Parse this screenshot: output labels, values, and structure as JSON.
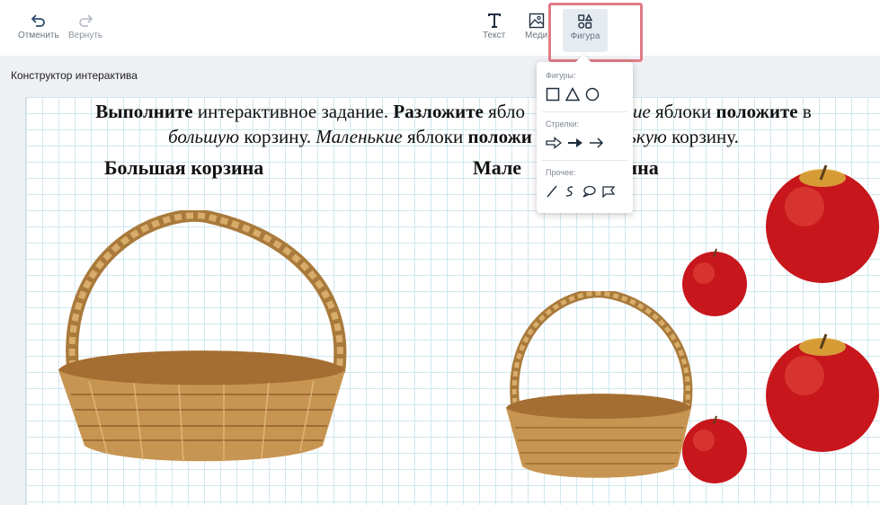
{
  "toolbar": {
    "undo_label": "Отменить",
    "redo_label": "Вернуть",
    "text_label": "Текст",
    "media_label": "Меди",
    "figure_label": "Фигура"
  },
  "page": {
    "constructor_label": "Конструктор интерактива"
  },
  "task": {
    "line1": [
      {
        "text": "Выполните",
        "style": "b"
      },
      {
        "text": " интерактивное задание. ",
        "style": ""
      },
      {
        "text": "Разложите",
        "style": "b"
      },
      {
        "text": " ябло",
        "style": ""
      }
    ],
    "line1_tail": [
      {
        "text": "ие",
        "style": "i"
      },
      {
        "text": " яблоки ",
        "style": ""
      },
      {
        "text": "положите",
        "style": "b"
      },
      {
        "text": " в",
        "style": ""
      }
    ],
    "line2": [
      {
        "text": "большую",
        "style": "i"
      },
      {
        "text": " корзину. ",
        "style": ""
      },
      {
        "text": "Маленькие",
        "style": "i"
      },
      {
        "text": " яблоки ",
        "style": ""
      },
      {
        "text": "положи",
        "style": "b"
      }
    ],
    "line2_tail": [
      {
        "text": "нькую",
        "style": "i"
      },
      {
        "text": " корзину.",
        "style": ""
      }
    ]
  },
  "headings": {
    "big_basket": "Большая корзина",
    "small_basket_left": "Мале",
    "small_basket_right": "рзина"
  },
  "dropdown": {
    "shapes_label": "Фигуры:",
    "arrows_label": "Стрелки:",
    "other_label": "Прочее:"
  },
  "colors": {
    "accent_highlight": "#e07a85",
    "grid": "#cfe7ee",
    "apple_red": "#c8161d",
    "basket": "#c79552"
  }
}
